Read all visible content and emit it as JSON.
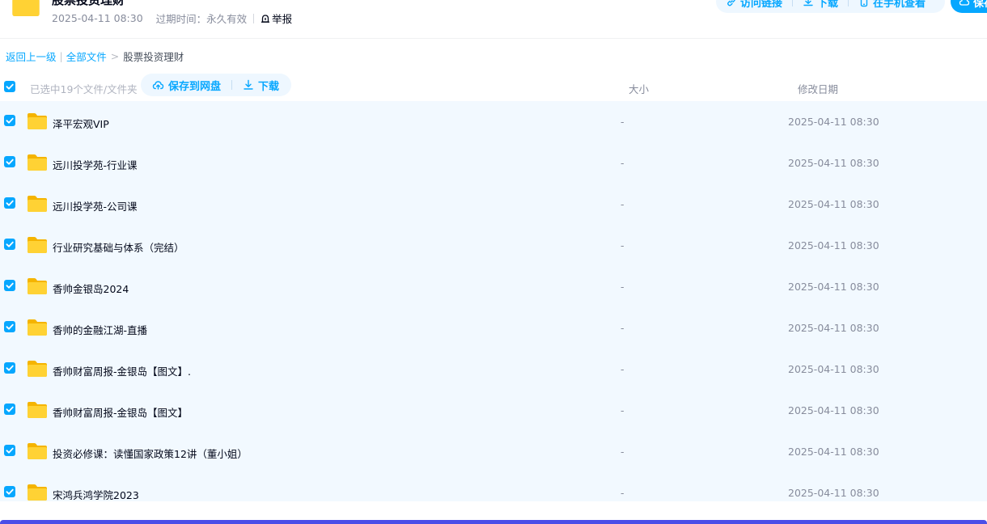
{
  "colors": {
    "accent": "#06a7ff",
    "list_bg": "#f2f9ff",
    "bottom_bar": "#4a4ee8",
    "folder": "#ffc928"
  },
  "header": {
    "title": "股票投资理财",
    "date": "2025-04-11 08:30",
    "expire": "过期时间：永久有效",
    "report_label": "举报",
    "report_icon": "report-icon",
    "actions": [
      {
        "label": "访问链接",
        "icon": "link-icon"
      },
      {
        "label": "下载",
        "icon": "download-icon"
      },
      {
        "label": "在手机查看",
        "icon": "phone-icon"
      }
    ],
    "save_label": "保存"
  },
  "breadcrumb": {
    "back": "返回上一级",
    "all": "全部文件",
    "current": "股票投资理财"
  },
  "list_header": {
    "selected": "已选中19个文件/文件夹",
    "save_label": "保存到网盘",
    "download_label": "下载",
    "size_col": "大小",
    "date_col": "修改日期"
  },
  "files": [
    {
      "name": "泽平宏观VIP",
      "size": "-",
      "date": "2025-04-11 08:30"
    },
    {
      "name": "远川投学苑-行业课",
      "size": "-",
      "date": "2025-04-11 08:30"
    },
    {
      "name": "远川投学苑-公司课",
      "size": "-",
      "date": "2025-04-11 08:30"
    },
    {
      "name": "行业研究基础与体系（完结）",
      "size": "-",
      "date": "2025-04-11 08:30"
    },
    {
      "name": "香帅金银岛2024",
      "size": "-",
      "date": "2025-04-11 08:30"
    },
    {
      "name": "香帅的金融江湖-直播",
      "size": "-",
      "date": "2025-04-11 08:30"
    },
    {
      "name": "香帅财富周报-金银岛【图文】.",
      "size": "-",
      "date": "2025-04-11 08:30"
    },
    {
      "name": "香帅财富周报-金银岛【图文】",
      "size": "-",
      "date": "2025-04-11 08:30"
    },
    {
      "name": "投资必修课：读懂国家政策12讲（董小姐）",
      "size": "-",
      "date": "2025-04-11 08:30"
    },
    {
      "name": "宋鸿兵鸿学院2023",
      "size": "-",
      "date": "2025-04-11 08:30"
    }
  ]
}
